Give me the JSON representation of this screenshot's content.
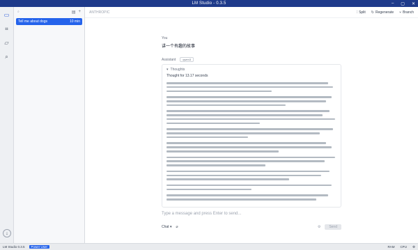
{
  "window": {
    "title": "LM Studio - 0.3.5"
  },
  "sidebar": {
    "search_placeholder": "",
    "chat_items": [
      {
        "label": "Tell me about dogs",
        "time": "10 min"
      }
    ]
  },
  "toolbar": {
    "left_text": "ANTHROPIC",
    "actions": [
      "Split",
      "Regenerate",
      "Branch"
    ]
  },
  "chat": {
    "you_label": "You",
    "user_message": "讲一个有趣的故事",
    "assistant_label": "Assistant",
    "model_name": "qwen3",
    "thought_header": "Thoughts",
    "thought_time": "Thought for 13.17 seconds"
  },
  "input": {
    "placeholder": "Type a message and press Enter to send...",
    "mode_label": "Chat",
    "send_label": "Send"
  },
  "status": {
    "app": "LM Studio 0.3.5",
    "mode": "Power User",
    "right_items": [
      "RAM",
      "CPU"
    ]
  }
}
